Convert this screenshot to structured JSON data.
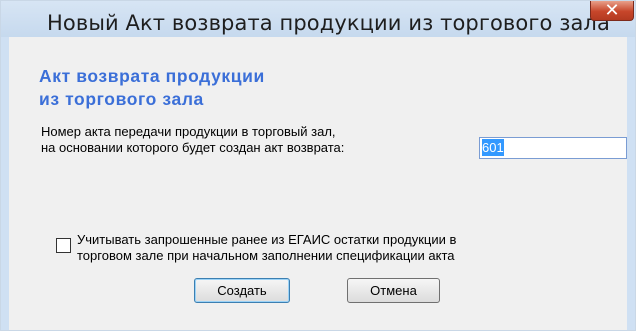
{
  "window": {
    "title": "Новый Акт возврата продукции из торгового зала",
    "close_icon": "close-x-icon",
    "colors": {
      "frame": "#cfe0f3",
      "close": "#c7462a",
      "heading": "#3b6fd8"
    }
  },
  "dialog": {
    "heading": "Акт возврата продукции\nиз торгового зала",
    "act_number_label": "Номер акта передачи продукции в торговый зал,\nна основании которого будет создан акт возврата:",
    "act_number_value": "601",
    "checkbox_checked": false,
    "checkbox_label": "Учитывать запрошенные ранее из ЕГАИС остатки продукции в\nторговом зале при начальном заполнении спецификации акта"
  },
  "buttons": {
    "create": "Создать",
    "cancel": "Отмена"
  }
}
